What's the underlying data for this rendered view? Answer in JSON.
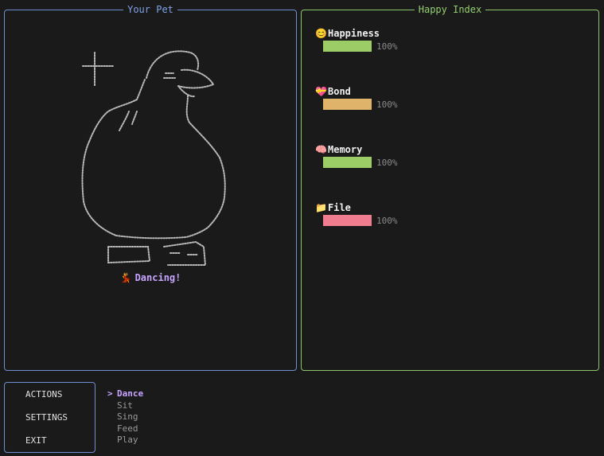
{
  "pet_panel": {
    "title": "Your Pet",
    "status_emoji": "💃",
    "status_text": "Dancing!"
  },
  "happy_panel": {
    "title": "Happy Index",
    "stats": [
      {
        "icon": "smiley-icon",
        "emoji": "😊",
        "label": "Happiness",
        "value": "100%",
        "fraction": 1.0,
        "color": "#9ccc65"
      },
      {
        "icon": "heart-icon",
        "emoji": "💝",
        "label": "Bond",
        "value": "100%",
        "fraction": 1.0,
        "color": "#e0b36a"
      },
      {
        "icon": "brain-icon",
        "emoji": "🧠",
        "label": "Memory",
        "value": "100%",
        "fraction": 1.0,
        "color": "#9ccc65"
      },
      {
        "icon": "folder-icon",
        "emoji": "📁",
        "label": "File",
        "value": "100%",
        "fraction": 1.0,
        "color": "#f07c8f"
      }
    ]
  },
  "menu": {
    "items": [
      "ACTIONS",
      "SETTINGS",
      "EXIT"
    ],
    "actions": {
      "cursor": ">",
      "selected": "Dance",
      "items": [
        "Dance",
        "Sit",
        "Sing",
        "Feed",
        "Play"
      ]
    }
  },
  "colors": {
    "pet_border": "#6f8fd0",
    "happy_border": "#8bc66a",
    "accent": "#c7a4ff"
  }
}
